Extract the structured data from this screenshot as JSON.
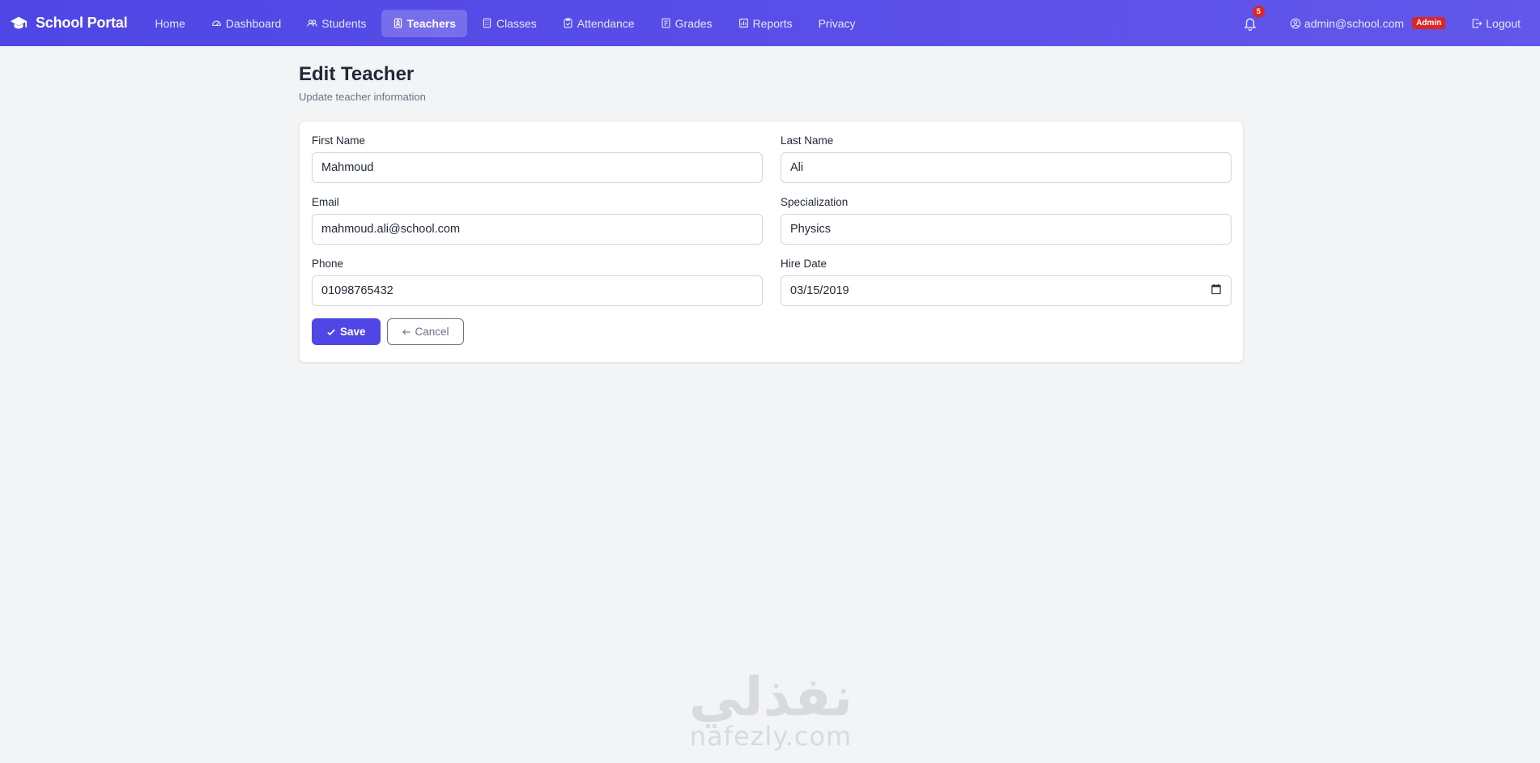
{
  "navbar": {
    "brand": "School Portal",
    "links": [
      {
        "label": "Home",
        "icon": "none"
      },
      {
        "label": "Dashboard",
        "icon": "gauge-icon"
      },
      {
        "label": "Students",
        "icon": "people-icon"
      },
      {
        "label": "Teachers",
        "icon": "person-badge-icon",
        "active": true
      },
      {
        "label": "Classes",
        "icon": "building-icon"
      },
      {
        "label": "Attendance",
        "icon": "clipboard-check-icon"
      },
      {
        "label": "Grades",
        "icon": "journal-icon"
      },
      {
        "label": "Reports",
        "icon": "bar-chart-icon"
      },
      {
        "label": "Privacy",
        "icon": "none"
      }
    ],
    "notification_count": "5",
    "user_email": "admin@school.com",
    "user_role": "Admin",
    "logout_label": "Logout"
  },
  "page": {
    "title": "Edit Teacher",
    "subtitle": "Update teacher information"
  },
  "form": {
    "first_name": {
      "label": "First Name",
      "value": "Mahmoud"
    },
    "last_name": {
      "label": "Last Name",
      "value": "Ali"
    },
    "email": {
      "label": "Email",
      "value": "mahmoud.ali@school.com"
    },
    "specialization": {
      "label": "Specialization",
      "value": "Physics"
    },
    "phone": {
      "label": "Phone",
      "value": "01098765432"
    },
    "hire_date": {
      "label": "Hire Date",
      "value": "03/15/2019"
    },
    "save_label": "Save",
    "cancel_label": "Cancel"
  },
  "watermark": {
    "arabic": "نفذلي",
    "latin": "nafezly.com"
  },
  "colors": {
    "navbar": "#4f46e5",
    "accent": "#4f46e5",
    "badge": "#dc2626",
    "background": "#f3f4f6"
  }
}
